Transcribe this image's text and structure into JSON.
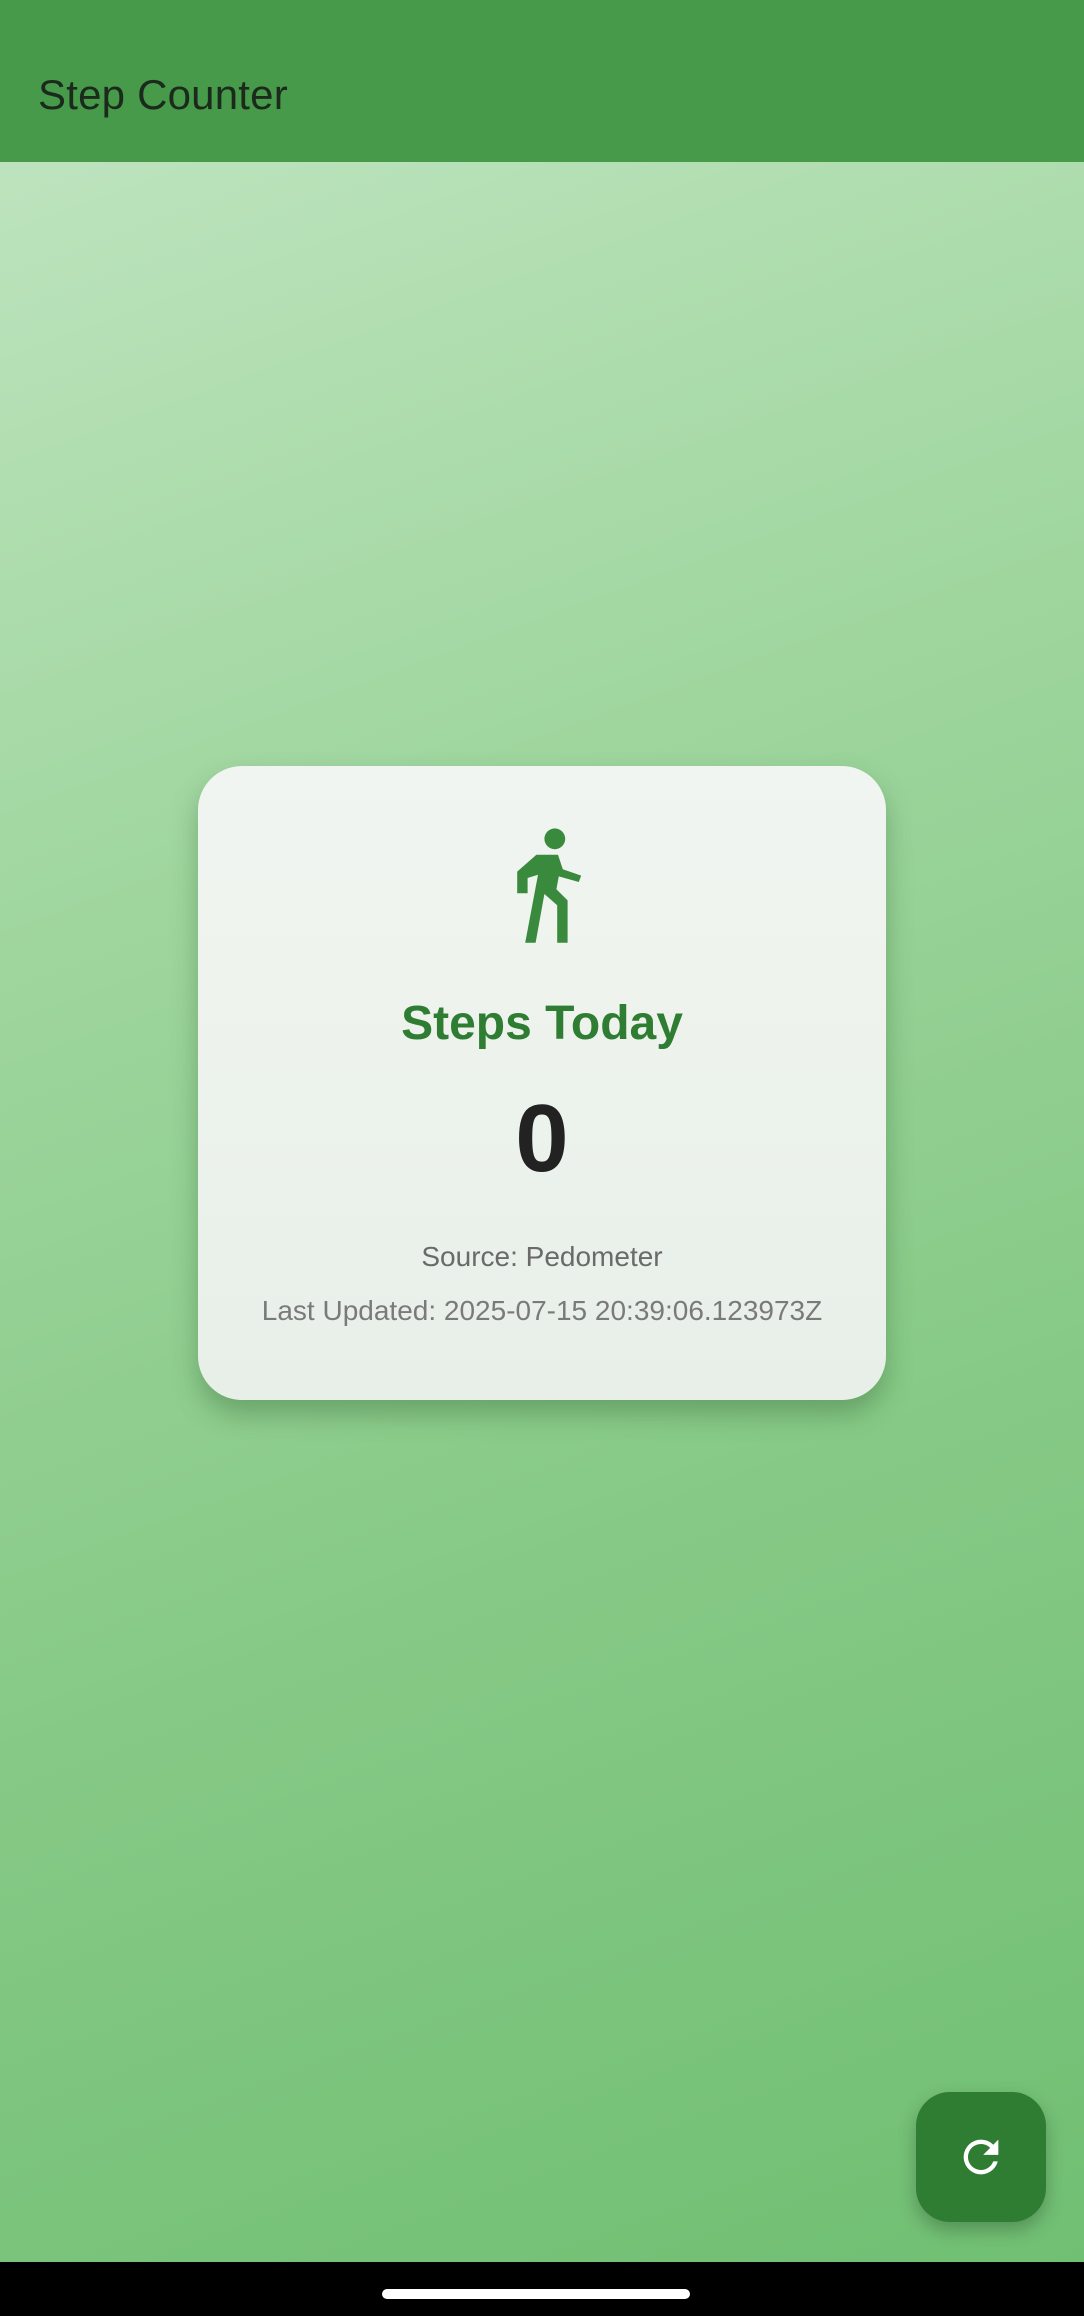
{
  "app_bar": {
    "title": "Step Counter"
  },
  "card": {
    "icon": "walking-person-icon",
    "title": "Steps Today",
    "step_count": "0",
    "source": "Source: Pedometer",
    "last_updated": "Last Updated: 2025-07-15 20:39:06.123973Z"
  },
  "fab": {
    "icon": "refresh-icon"
  },
  "colors": {
    "app_bar": "#469a49",
    "accent": "#2e7d32",
    "card_title": "#2f7d32"
  }
}
